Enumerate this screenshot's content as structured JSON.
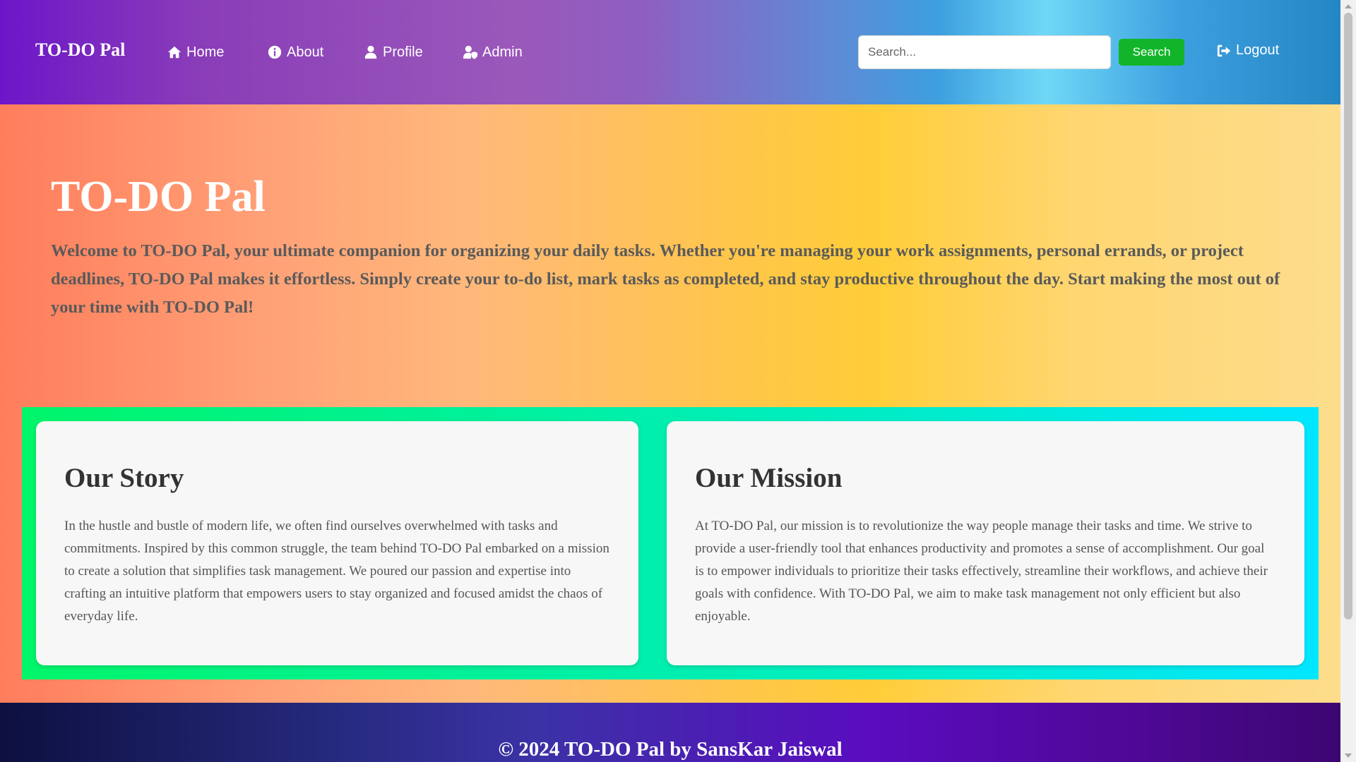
{
  "nav": {
    "brand": "TO-DO Pal",
    "links": [
      {
        "label": "Home",
        "icon": "home-icon"
      },
      {
        "label": "About",
        "icon": "info-icon"
      },
      {
        "label": "Profile",
        "icon": "user-icon"
      },
      {
        "label": "Admin",
        "icon": "user-shield-icon"
      }
    ],
    "search_placeholder": "Search...",
    "search_button": "Search",
    "logout_label": "Logout",
    "logout_icon": "logout-icon"
  },
  "hero": {
    "title": "TO-DO Pal",
    "text": "Welcome to TO-DO Pal, your ultimate companion for organizing your daily tasks. Whether you're managing your work assignments, personal errands, or project deadlines, TO-DO Pal makes it effortless. Simply create your to-do list, mark tasks as completed, and stay productive throughout the day. Start making the most out of your time with TO-DO Pal!"
  },
  "cards": [
    {
      "title": "Our Story",
      "text": "In the hustle and bustle of modern life, we often find ourselves overwhelmed with tasks and commitments. Inspired by this common struggle, the team behind TO-DO Pal embarked on a mission to create a solution that simplifies task management. We poured our passion and expertise into crafting an intuitive platform that empowers users to stay organized and focused amidst the chaos of everyday life."
    },
    {
      "title": "Our Mission",
      "text": "At TO-DO Pal, our mission is to revolutionize the way people manage their tasks and time. We strive to provide a user-friendly tool that enhances productivity and promotes a sense of accomplishment. Our goal is to empower individuals to prioritize their tasks effectively, streamline their workflows, and achieve their goals with confidence. With TO-DO Pal, we aim to make task management not only efficient but also enjoyable."
    }
  ],
  "footer": {
    "text": "© 2024 TO-DO Pal by SansKar Jaiswal"
  },
  "colors": {
    "search_button": "#12b52a",
    "hero_text": "#5a5a5a",
    "card_background": "#f7f7f7"
  }
}
